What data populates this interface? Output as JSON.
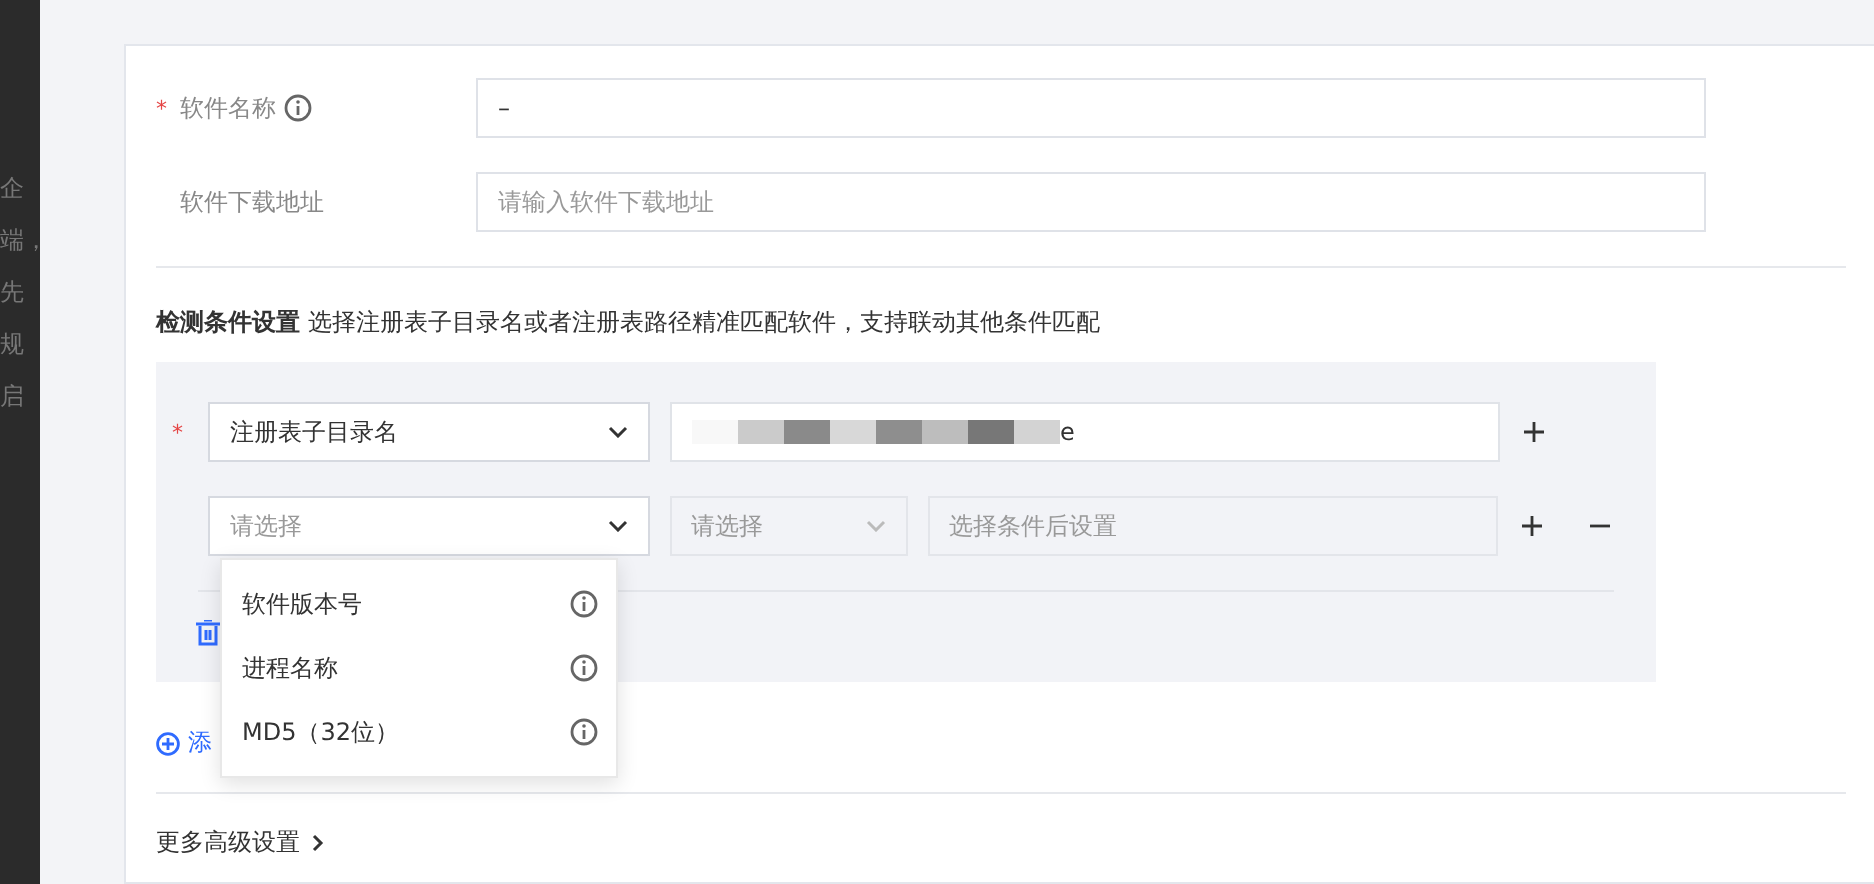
{
  "background_fragments": [
    "企",
    "端，",
    "先",
    "规",
    "启"
  ],
  "fields": [
    {
      "required_mark": "*",
      "label": "软件名称",
      "info": true,
      "value": "–"
    },
    {
      "label": "软件下载地址",
      "placeholder": "请输入软件下载地址"
    }
  ],
  "conditions": {
    "heading": "**检测条件设置** 选择注册表子目录名或者注册表路径精准匹配软件，支持联动其他条件匹配",
    "rows": [
      {
        "required_mark": "*",
        "type": "注册表子目录名",
        "value": "e"
      },
      {
        "type_placeholder": "请选择",
        "operator_placeholder": "请选择",
        "value_placeholder": "选择条件后设置",
        "removable": true
      }
    ],
    "dropdown": [
      {
        "label": "软件版本号"
      },
      {
        "label": "进程名称"
      },
      {
        "label": "MD5（32位）"
      }
    ],
    "add_link": "添"
  },
  "advanced": "更多高级设置"
}
